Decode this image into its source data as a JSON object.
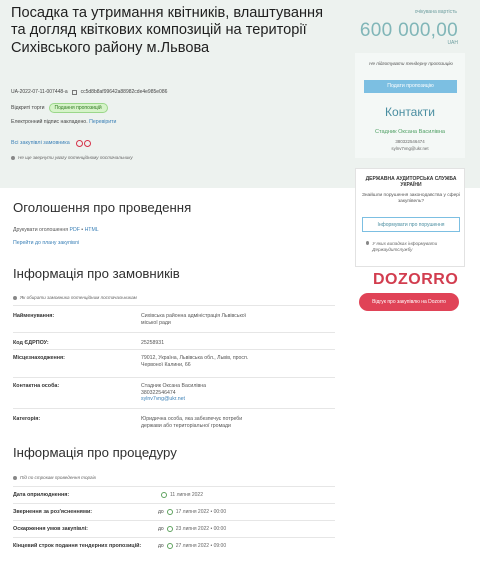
{
  "header": {
    "title": "Посадка та утримання квітників, влаштування та догляд квіткових композицій на території Сихівського району м.Львова",
    "tender_id": "UA-2022-07-11-007448-a",
    "tender_hash": "cc5d8b8af99642a88982cde4e985e086",
    "status_label": "Відкриті торги",
    "status_badge": "Подання пропозицій",
    "signature_text": "Електронний підпис накладено.",
    "signature_link": "Перевірити",
    "all_purchases_label": "Всі закупівлі замовника",
    "notice": "Не ще звернути увагу потенційному постачальнику"
  },
  "price": {
    "label": "очікувана вартість",
    "amount": "600 000,00",
    "currency": "UAH"
  },
  "side": {
    "warning": "Не підготувати тендерну пропозицію",
    "offers_button": "Подати пропозицію",
    "contacts_title": "Контакти",
    "contact_name": "Стадник Оксана Василівна",
    "contact_phone": "380322546474",
    "contact_email": "sylnv7vng@ukr.net"
  },
  "audit": {
    "title": "ДЕРЖАВНА АУДИТОРСЬКА СЛУЖБА УКРАЇНИ",
    "question": "Знайшли порушення законодавства у сфері закупівель?",
    "button": "Інформувати про порушення",
    "note": "У яких випадках інформувати Держаудитслужбу"
  },
  "dozorro": {
    "logo": "DOZORRO",
    "button": "Відгук про закупівлю на Dozorro"
  },
  "announcement": {
    "title": "Оголошення про проведення",
    "docs_prefix": "Друкувати оголошення",
    "docs_pdf": "PDF",
    "docs_html": "HTML",
    "plan_link": "Перейти до плану закупівлі"
  },
  "customer": {
    "title": "Інформація про замовників",
    "note": "Як обирати замовника потенційним постачальникам",
    "rows": [
      {
        "k": "Найменування:",
        "v": "Сихівська районна адміністрація Львівської міської ради"
      },
      {
        "k": "Код ЄДРПОУ:",
        "v": "25258931"
      },
      {
        "k": "Місцезнаходження:",
        "v": "79012, Україна, Львівська обл., Львів, просп. Червоної Калини, 66"
      },
      {
        "k": "Контактна особа:",
        "v": "Стадник Оксана Василівна",
        "v2": "380322546474",
        "v3": "sylnv7vng@ukr.net"
      },
      {
        "k": "Категорія:",
        "v": "Юридична особа, яка забезпечує потреби держави або територіальної громади"
      }
    ]
  },
  "procedure": {
    "title": "Інформація про процедуру",
    "note": "Під по строкам проведення торгів",
    "rows": [
      {
        "k": "Дата оприлюднення:",
        "pre": "",
        "v": "11 липня 2022"
      },
      {
        "k": "Звернення за роз'ясненнями:",
        "pre": "до",
        "v": "17 липня 2022 • 00:00"
      },
      {
        "k": "Оскарження умов закупівлі:",
        "pre": "до",
        "v": "23 липня 2022 • 00:00"
      },
      {
        "k": "Кінцевий строк подання тендерних пропозицій:",
        "pre": "до",
        "v": "27 липня 2022 • 09:00"
      }
    ]
  },
  "colors": {
    "header_bg": "#edf2ef",
    "accent_blue": "#3b80b7",
    "price": "#81b6b8",
    "dozorro_red": "#e04357",
    "badge_green": "#d6f3c9"
  }
}
